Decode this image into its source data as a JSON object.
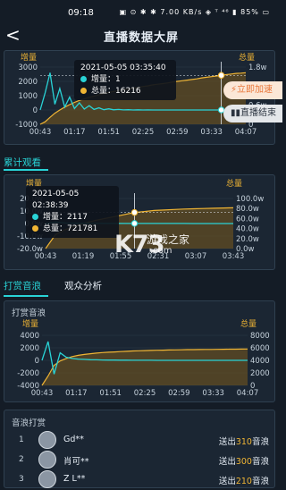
{
  "status_bar": {
    "time": "09:18",
    "icons_text": "▣ ⊙ ✱ ✱ 7.00 KB/s ◈ ᵀ ⁴⁶ ▮ 85% ▭",
    "battery": "85%"
  },
  "header": {
    "title": "直播数据大屏",
    "back_label": "<"
  },
  "float_buttons": {
    "boost": "立即加速",
    "end": "直播结束"
  },
  "chart1": {
    "left_label": "增量",
    "right_label": "总量",
    "tooltip": {
      "time": "2021-05-05 03:35:40",
      "inc_label": "增量：",
      "inc_value": "1",
      "total_label": "总量：",
      "total_value": "16216"
    }
  },
  "section_cumulative": "累计观看",
  "chart2": {
    "left_label": "增量",
    "right_label": "总量",
    "tooltip": {
      "time": "2021-05-05 02:38:39",
      "inc_label": "增量：",
      "inc_value": "2117",
      "total_label": "总量：",
      "total_value": "721781"
    }
  },
  "tabs": [
    {
      "label": "打赏音浪"
    },
    {
      "label": "观众分析"
    }
  ],
  "gift_wave": {
    "card_title": "打赏音浪",
    "left_label": "增量",
    "right_label": "总量"
  },
  "gift_list": {
    "title": "音浪打赏",
    "rows": [
      {
        "rank": "1",
        "name": "Gd**",
        "prefix": "送出",
        "amount": "310",
        "suffix": "音浪"
      },
      {
        "rank": "2",
        "name": "肖可**",
        "prefix": "送出",
        "amount": "300",
        "suffix": "音浪"
      },
      {
        "rank": "3",
        "name": "Z L**",
        "prefix": "送出",
        "amount": "210",
        "suffix": "音浪"
      }
    ]
  },
  "watermark": {
    "logo": "K73",
    "sub": ".com",
    "text": "游戏之家"
  },
  "colors": {
    "accent": "#29d3d6",
    "gold": "#f0b534",
    "bg": "#141c26",
    "card": "#1b2633",
    "boost_text": "#e8763a"
  },
  "chart_data": [
    {
      "type": "line",
      "x_ticks": [
        "00:43",
        "01:17",
        "01:51",
        "02:25",
        "02:59",
        "03:33",
        "04:07"
      ],
      "y_left_ticks": [
        "3000",
        "2000",
        "1000",
        "0",
        "-1000"
      ],
      "y_right_ticks": [
        "1.8w",
        "1.2w",
        "0.6w",
        "0"
      ],
      "series": [
        {
          "name": "增量",
          "color": "#29d3d6",
          "values": [
            0,
            1200,
            2600,
            400,
            1500,
            200,
            900,
            100,
            500,
            60,
            300,
            40,
            150,
            20,
            80,
            10,
            40,
            5,
            20,
            3,
            10,
            1,
            5,
            1,
            2,
            1,
            1,
            1,
            1,
            1,
            1,
            1,
            1,
            1,
            1,
            1,
            1,
            1,
            1,
            1,
            1,
            1,
            1
          ]
        },
        {
          "name": "总量",
          "color": "#f0b534",
          "values": [
            0,
            800,
            2200,
            3500,
            4500,
            5400,
            6200,
            6900,
            7500,
            8000,
            8500,
            8900,
            9300,
            9700,
            10000,
            10300,
            10600,
            10900,
            11100,
            11400,
            11600,
            11900,
            12100,
            12400,
            12600,
            12800,
            13000,
            13300,
            13500,
            13700,
            13900,
            14100,
            14300,
            14600,
            14800,
            15000,
            15200,
            15400,
            15600,
            15800,
            16000,
            16100,
            16216
          ]
        }
      ]
    },
    {
      "type": "line",
      "x_ticks": [
        "00:43",
        "01:19",
        "01:55",
        "02:31",
        "03:07",
        "03:43"
      ],
      "y_left_ticks": [
        "20.0w",
        "10.0w",
        "0.0w",
        "-10.0w",
        "-20.0w"
      ],
      "y_right_ticks": [
        "100.0w",
        "80.0w",
        "60.0w",
        "40.0w",
        "20.0w",
        "0.0w"
      ],
      "series": [
        {
          "name": "增量",
          "color": "#29d3d6",
          "values": [
            0,
            12000,
            4000,
            2500,
            2000,
            1800,
            1500,
            1200,
            1000,
            900,
            800,
            700,
            600,
            500,
            400,
            300,
            200,
            150,
            100,
            50
          ]
        },
        {
          "name": "总量",
          "color": "#f0b534",
          "values": [
            0,
            280000,
            380000,
            450000,
            510000,
            560000,
            600000,
            640000,
            680000,
            721781,
            740000,
            760000,
            770000,
            780000,
            790000,
            795000,
            800000,
            805000,
            810000,
            815000
          ]
        }
      ]
    },
    {
      "type": "line",
      "x_ticks": [
        "00:43",
        "01:17",
        "01:51",
        "02:25",
        "02:59",
        "03:33",
        "04:07"
      ],
      "y_left_ticks": [
        "4000",
        "2000",
        "0",
        "-2000",
        "-4000"
      ],
      "y_right_ticks": [
        "8000",
        "6000",
        "4000",
        "2000",
        "0"
      ],
      "series": [
        {
          "name": "增量",
          "color": "#29d3d6",
          "values": [
            0,
            3000,
            -2200,
            1200,
            500,
            300,
            200,
            150,
            100,
            80,
            60,
            50,
            40,
            30,
            25,
            20,
            15,
            10,
            8,
            6,
            5,
            4,
            3,
            2,
            2,
            1,
            1,
            1,
            1,
            1,
            1,
            1,
            1,
            1,
            1
          ]
        },
        {
          "name": "总量",
          "color": "#f0b534",
          "values": [
            0,
            1500,
            3200,
            3900,
            4300,
            4600,
            4800,
            4950,
            5050,
            5150,
            5250,
            5300,
            5350,
            5400,
            5450,
            5500,
            5530,
            5560,
            5590,
            5610,
            5630,
            5650,
            5670,
            5690,
            5710,
            5720,
            5730,
            5740,
            5750,
            5760,
            5770,
            5780,
            5790,
            5800,
            5810
          ]
        }
      ]
    }
  ]
}
